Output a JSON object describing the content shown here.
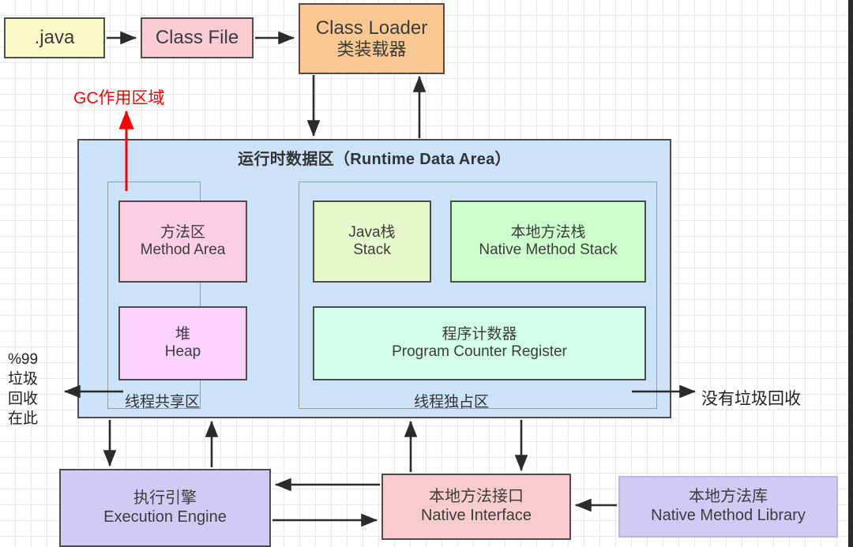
{
  "diagram": {
    "title": "JVM Architecture Diagram",
    "grid": {
      "enabled": true,
      "spacing_px": 20,
      "color": "#e8e8e8"
    }
  },
  "pipeline": {
    "java_file": {
      "label": ".java"
    },
    "class_file": {
      "label": "Class File"
    },
    "class_loader": {
      "cn": "类装载器",
      "en": "Class Loader"
    }
  },
  "runtime_area": {
    "title": "运行时数据区（Runtime Data Area）",
    "shared_region_label": "线程共享区",
    "exclusive_region_label": "线程独占区",
    "method_area": {
      "cn": "方法区",
      "en": "Method Area",
      "color": "#FCCEE2"
    },
    "heap": {
      "cn": "堆",
      "en": "Heap",
      "color": "#FBD2FF"
    },
    "java_stack": {
      "cn": "Java栈",
      "en": "Stack",
      "color": "#E6F8CC"
    },
    "native_method_stack": {
      "cn": "本地方法栈",
      "en": "Native Method Stack",
      "color": "#CCFFCC"
    },
    "pc_register": {
      "cn": "程序计数器",
      "en": "Program Counter Register",
      "color": "#D1FFE9"
    }
  },
  "bottom": {
    "execution_engine": {
      "cn": "执行引擎",
      "en": "Execution Engine",
      "color": "#CFCBF4"
    },
    "native_interface": {
      "cn": "本地方法接口",
      "en": "Native Interface",
      "color": "#F8CCCF"
    },
    "native_method_library": {
      "cn": "本地方法库",
      "en": "Native Method Library",
      "color": "#CFCBF4"
    }
  },
  "annotations": {
    "gc_scope": {
      "text": "GC作用区域",
      "color": "#FF0000"
    },
    "no_gc": {
      "text": "没有垃圾回收"
    },
    "gc99": {
      "lines": [
        "%99",
        "垃圾",
        "回收",
        "在此"
      ],
      "text": "%99\n垃圾\n回收\n在此"
    }
  }
}
